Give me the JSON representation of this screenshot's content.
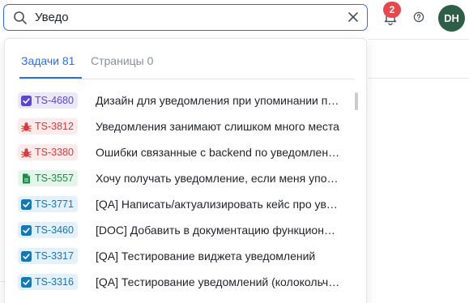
{
  "search": {
    "value": "Уведо",
    "placeholder": ""
  },
  "header": {
    "notification_count": "2",
    "avatar_initials": "DH"
  },
  "tabs": [
    {
      "label": "Задачи 81",
      "active": true
    },
    {
      "label": "Страницы 0",
      "active": false
    }
  ],
  "results": [
    {
      "key": "TS-4680",
      "type": "task",
      "color": "purple",
      "title": "Дизайн для уведомления при упоминании пользователя"
    },
    {
      "key": "TS-3812",
      "type": "bug",
      "color": "red",
      "title": "Уведомления занимают слишком много места"
    },
    {
      "key": "TS-3380",
      "type": "bug",
      "color": "red",
      "title": "Ошибки связанные с backend по уведомлениям"
    },
    {
      "key": "TS-3557",
      "type": "story",
      "color": "green",
      "title": "Хочу получать уведомление, если меня упомянули"
    },
    {
      "key": "TS-3771",
      "type": "task",
      "color": "blue",
      "title": "[QA] Написать/актуализировать кейс про уведомления"
    },
    {
      "key": "TS-3460",
      "type": "task",
      "color": "blue",
      "title": "[DOC] Добавить в документацию функционал уведомлений"
    },
    {
      "key": "TS-3317",
      "type": "task",
      "color": "blue",
      "title": "[QA] Тестирование виджета уведомлений"
    },
    {
      "key": "TS-3316",
      "type": "task",
      "color": "blue",
      "title": "[QA] Тестирование уведомлений (колокольчик)"
    }
  ],
  "colors": {
    "accent": "#2f6fde",
    "badge": "#e5484d",
    "avatar": "#2e5e45",
    "purple": "#5b47c9",
    "red": "#d73a3a",
    "green": "#1e8a47",
    "blue": "#1677b3"
  },
  "icons": {
    "task": "checkbox-icon",
    "bug": "bug-icon",
    "story": "document-icon"
  }
}
